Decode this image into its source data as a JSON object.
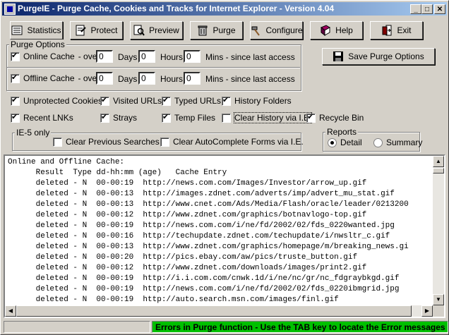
{
  "window": {
    "title": "PurgeIE - Purge Cache, Cookies and Tracks for Internet Explorer  -  Version 4.04"
  },
  "toolbar": {
    "statistics": "Statistics",
    "protect": "Protect",
    "preview": "Preview",
    "purge": "Purge",
    "configure": "Configure",
    "help": "Help",
    "exit": "Exit"
  },
  "purge_options": {
    "label": "Purge Options",
    "online": {
      "label": "Online Cache",
      "over": "- over",
      "days": "0",
      "hours": "0",
      "mins": "0",
      "checked": true
    },
    "offline": {
      "label": "Offline Cache",
      "over": "- over",
      "days": "0",
      "hours": "0",
      "mins": "0",
      "checked": true
    },
    "days_label": "Days",
    "hours_label": "Hours",
    "mins_label": "Mins - since last access",
    "save_button": "Save Purge Options"
  },
  "options": {
    "unprotected_cookies": "Unprotected Cookies",
    "visited_urls": "Visited URLs",
    "typed_urls": "Typed URLs",
    "history_folders": "History Folders",
    "recent_lnks": "Recent LNKs",
    "strays": "Strays",
    "temp_files": "Temp Files",
    "clear_history": "Clear History via I.E.",
    "recycle_bin": "Recycle Bin"
  },
  "ie5": {
    "label": "IE-5 only",
    "clear_prev": "Clear Previous Searches",
    "clear_autocomplete": "Clear AutoComplete Forms via I.E."
  },
  "reports": {
    "label": "Reports",
    "detail": "Detail",
    "summary": "Summary",
    "selected": "Detail"
  },
  "log": {
    "header1": "Online and Offline Cache:",
    "header2": "      Result  Type dd-hh:mm (age)   Cache Entry",
    "lines": [
      "      deleted - N  00-00:19  http://news.com.com/Images/Investor/arrow_up.gif",
      "      deleted - N  00-00:13  http://images.zdnet.com/adverts/imp/advert_mu_stat.gif",
      "      deleted - N  00-00:13  http://www.cnet.com/Ads/Media/Flash/oracle/leader/0213200",
      "      deleted - N  00-00:12  http://www.zdnet.com/graphics/botnavlogo-top.gif",
      "      deleted - N  00-00:19  http://news.com.com/i/ne/fd/2002/02/fds_0220wanted.jpg",
      "      deleted - N  00-00:16  http://techupdate.zdnet.com/techupdate/i/nwsltr_c.gif",
      "      deleted - N  00-00:13  http://www.zdnet.com/graphics/homepage/m/breaking_news.gi",
      "      deleted - N  00-00:20  http://pics.ebay.com/aw/pics/truste_button.gif",
      "      deleted - N  00-00:12  http://www.zdnet.com/downloads/images/print2.gif",
      "      deleted - N  00-00:19  http://i.i.com.com/cnwk.1d/i/ne/nc/gr/nc_fdgraybkgd.gif",
      "      deleted - N  00-00:19  http://news.com.com/i/ne/fd/2002/02/fds_0220ibmgrid.jpg",
      "      deleted - N  00-00:19  http://auto.search.msn.com/images/finl.gif"
    ]
  },
  "status": {
    "message": "Errors in Purge function  -  Use the TAB key to locate the Error messages"
  }
}
